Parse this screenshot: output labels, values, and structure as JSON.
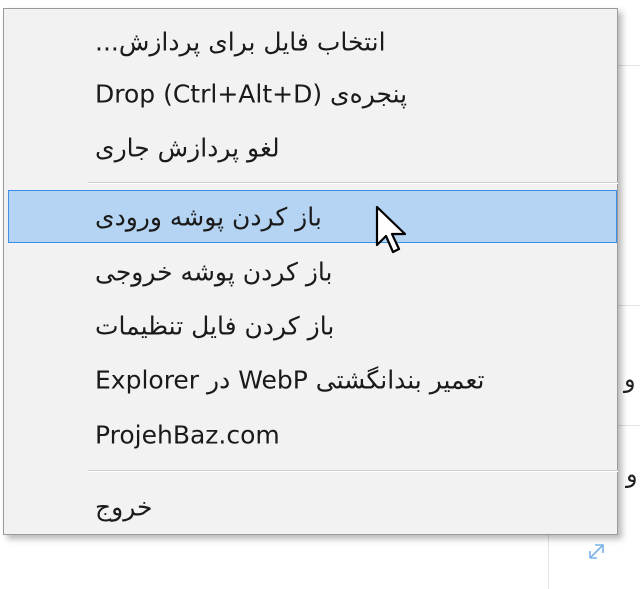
{
  "menu": {
    "items": [
      {
        "label": "انتخاب فایل برای پردازش..."
      },
      {
        "label": "پنجره‌ی Drop (Ctrl+Alt+D)"
      },
      {
        "label": "لغو پردازش جاری"
      },
      {
        "label": "باز کردن پوشه ورودی"
      },
      {
        "label": "باز کردن پوشه خروجی"
      },
      {
        "label": "باز کردن فایل تنظیمات"
      },
      {
        "label": "تعمیر بندانگشتی WebP در Explorer"
      },
      {
        "label": "ProjehBaz.com"
      },
      {
        "label": "خروج"
      }
    ],
    "selected_index": 3,
    "highlight_color": "#b5d3f2",
    "highlight_border_color": "#3d8ee6"
  },
  "background": {
    "glyph_right_1": "و",
    "glyph_right_2": "و"
  }
}
